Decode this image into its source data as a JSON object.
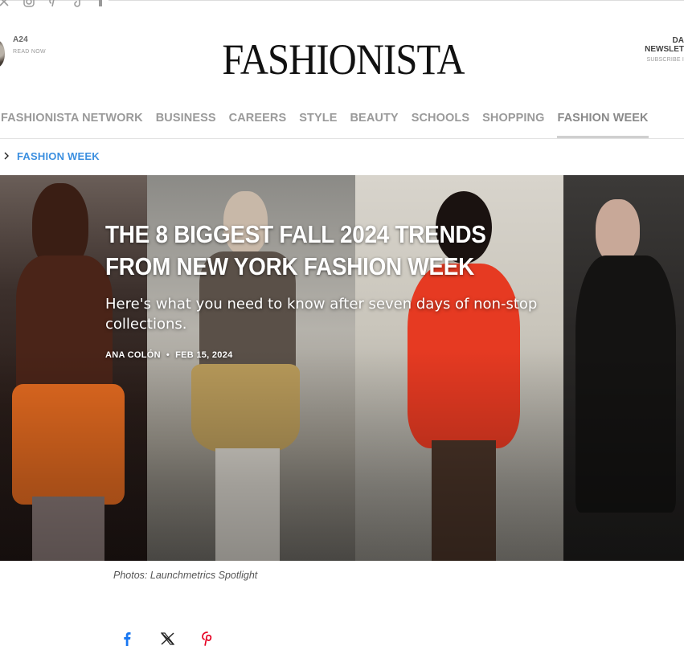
{
  "social": {
    "icons": [
      "x-icon",
      "instagram-icon",
      "pinterest-icon",
      "tiktok-icon",
      "flipboard-icon"
    ]
  },
  "promo_left": {
    "title": "A24",
    "cta": "READ NOW"
  },
  "logo": "FASHIONISTA",
  "promo_right": {
    "line1": "DA",
    "line2": "NEWSLET",
    "line3": "SUBSCRIBE I"
  },
  "nav": {
    "items": [
      {
        "label": "FASHIONISTA NETWORK"
      },
      {
        "label": "BUSINESS"
      },
      {
        "label": "CAREERS"
      },
      {
        "label": "STYLE"
      },
      {
        "label": "BEAUTY"
      },
      {
        "label": "SCHOOLS"
      },
      {
        "label": "SHOPPING"
      },
      {
        "label": "FASHION WEEK"
      }
    ],
    "active": "FASHION WEEK"
  },
  "breadcrumb": {
    "label": "FASHION WEEK"
  },
  "article": {
    "headline": "THE 8 BIGGEST FALL 2024 TRENDS FROM NEW YORK FASHION WEEK",
    "dek": "Here's what you need to know after seven days of non-stop collections.",
    "author": "ANA COLÓN",
    "separator": "•",
    "date": "FEB 15, 2024",
    "caption": "Photos: Launchmetrics Spotlight"
  },
  "share": {
    "icons": [
      "facebook-icon",
      "x-icon",
      "pinterest-icon"
    ]
  },
  "colors": {
    "breadcrumb": "#3b8fe0",
    "facebook": "#1877f2",
    "pinterest": "#e60023"
  }
}
